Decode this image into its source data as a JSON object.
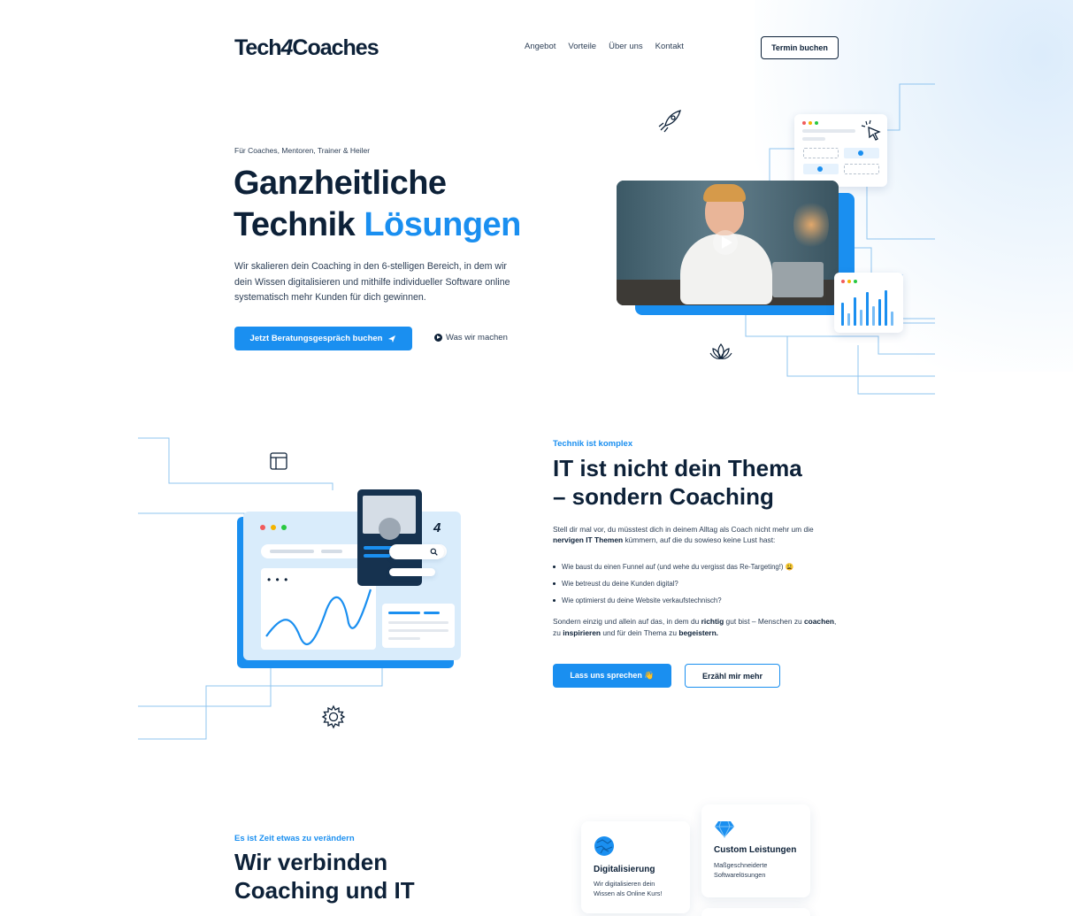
{
  "header": {
    "logo_prefix": "Tech",
    "logo_num": "4",
    "logo_suffix": "Coaches",
    "nav": [
      "Angebot",
      "Vorteile",
      "Über uns",
      "Kontakt"
    ],
    "cta": "Termin buchen"
  },
  "hero": {
    "eyebrow": "Für Coaches, Mentoren, Trainer & Heiler",
    "title_line1": "Ganzheitliche",
    "title_line2_plain": "Technik ",
    "title_line2_accent": "Lösungen",
    "text": "Wir skalieren dein Coaching in den 6-stelligen Bereich, in dem wir dein Wissen digitalisieren und mithilfe individueller Software online systematisch mehr Kunden für dich gewinnen.",
    "primary_cta": "Jetzt Beratungsgespräch buchen",
    "secondary_cta": "Was wir machen"
  },
  "section2": {
    "eyebrow": "Technik ist komplex",
    "title_line1": "IT ist nicht dein Thema",
    "title_line2": "– sondern Coaching",
    "intro_a": "Stell dir mal vor, du müsstest dich in deinem Alltag als Coach nicht mehr um die ",
    "intro_b": "nervigen IT Themen",
    "intro_c": " kümmern, auf die du sowieso keine Lust hast:",
    "bullets": [
      "Wie baust du einen Funnel auf (und wehe du vergisst das Re-Targeting!) 😩",
      "Wie betreust du deine Kunden digital?",
      "Wie optimierst du deine Website verkaufstechnisch?"
    ],
    "outro_a": "Sondern einzig und allein auf das, in dem du ",
    "outro_b": "richtig",
    "outro_c": " gut bist – Menschen zu ",
    "outro_d": "coachen",
    "outro_e": ", zu ",
    "outro_f": "inspirieren",
    "outro_g": " und für dein Thema zu ",
    "outro_h": "begeistern.",
    "cta_primary": "Lass uns sprechen 👋",
    "cta_secondary": "Erzähl mir mehr"
  },
  "section3": {
    "eyebrow": "Es ist Zeit etwas zu verändern",
    "title_line1": "Wir verbinden",
    "title_line2": "Coaching und IT",
    "cards": [
      {
        "title": "Digitalisierung",
        "desc": "Wir digitalisieren dein Wissen als Online Kurs!"
      },
      {
        "title": "Custom Leistungen",
        "desc": "Maßgeschneiderte Softwarelösungen"
      }
    ]
  },
  "colors": {
    "accent": "#1a8ff0",
    "navy": "#0d2138",
    "text": "#2c3e55"
  },
  "icons": [
    "rocket-icon",
    "cursor-icon",
    "lotus-icon",
    "layout-icon",
    "gear-icon",
    "search-icon",
    "diamond-icon",
    "globe-icon",
    "play-icon",
    "hand-wave-icon",
    "paper-plane-icon"
  ]
}
